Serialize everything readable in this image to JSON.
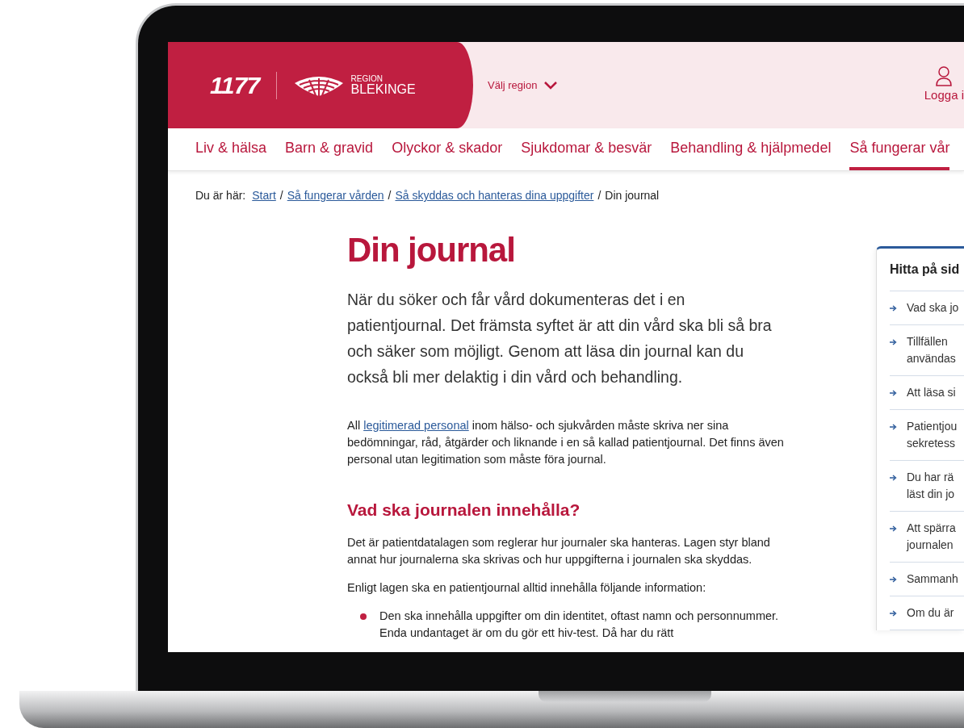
{
  "header": {
    "logo_text": "1177",
    "region_small": "REGION",
    "region_name": "BLEKINGE",
    "region_select": "Välj region",
    "login": "Logga i"
  },
  "nav": [
    {
      "label": "Liv & hälsa",
      "selected": false
    },
    {
      "label": "Barn & gravid",
      "selected": false
    },
    {
      "label": "Olyckor & skador",
      "selected": false
    },
    {
      "label": "Sjukdomar & besvär",
      "selected": false
    },
    {
      "label": "Behandling & hjälpmedel",
      "selected": false
    },
    {
      "label": "Så fungerar vår",
      "selected": true
    }
  ],
  "breadcrumb": {
    "prefix": "Du är här:",
    "separator": "/",
    "links": [
      "Start",
      "Så fungerar vården",
      "Så skyddas och hanteras dina uppgifter"
    ],
    "current": "Din journal"
  },
  "article": {
    "title": "Din journal",
    "lead": "När du söker och får vård dokumenteras det i en patientjournal. Det främsta syftet är att din vård ska bli så bra och säker som möjligt. Genom att läsa din journal kan du också bli mer delaktig i din vård och behandling.",
    "intro": {
      "before": "All",
      "link": "legitimerad personal",
      "after": "inom hälso- och sjukvården måste skriva ner sina bedömningar, råd, åtgärder och liknande i en så kallad patientjournal. Det finns även personal utan legitimation som måste föra journal."
    },
    "heading": "Vad ska journalen innehålla?",
    "paragraphs": [
      "Det är patientdatalagen som reglerar hur journaler ska hanteras. Lagen styr bland annat hur journalerna ska skrivas och hur uppgifterna i journalen ska skyddas.",
      "Enligt lagen ska en patientjournal alltid innehålla följande information:"
    ],
    "bullets": [
      "Den ska innehålla uppgifter om din identitet, oftast namn och personnummer. Enda undantaget är om du gör ett hiv-test. Då har du rätt"
    ]
  },
  "toc": {
    "title": "Hitta på sid",
    "items": [
      [
        "Vad ska jo"
      ],
      [
        "Tillfällen",
        "användas"
      ],
      [
        "Att läsa si"
      ],
      [
        "Patientjou",
        "sekretess"
      ],
      [
        "Du har rä",
        "läst din jo"
      ],
      [
        "Att spärra",
        "journalen"
      ],
      [
        "Sammanh"
      ],
      [
        "Om du är"
      ]
    ]
  }
}
